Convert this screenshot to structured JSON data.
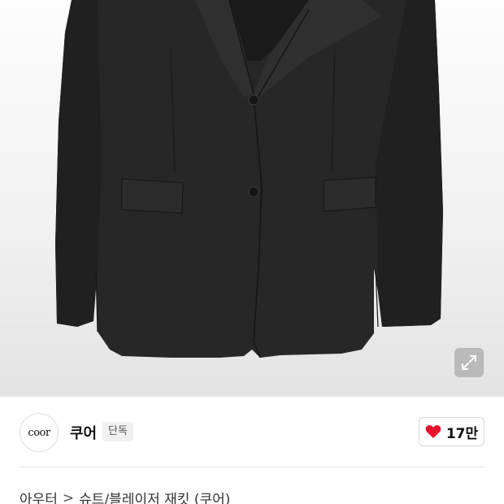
{
  "brand": {
    "logo_text": "coor",
    "name": "쿠어",
    "badge": "단독"
  },
  "like": {
    "count": "17만",
    "color": "#e8112d"
  },
  "breadcrumb": {
    "category": "아우터",
    "separator": ">",
    "subcategory": "슈트/블레이저 재킷 (쿠어)"
  },
  "icons": {
    "expand": "expand-icon",
    "like": "heart-icon",
    "separator": "chevron-right-icon"
  },
  "colors": {
    "jacket": "#262626",
    "background": "#f1f1f1"
  }
}
